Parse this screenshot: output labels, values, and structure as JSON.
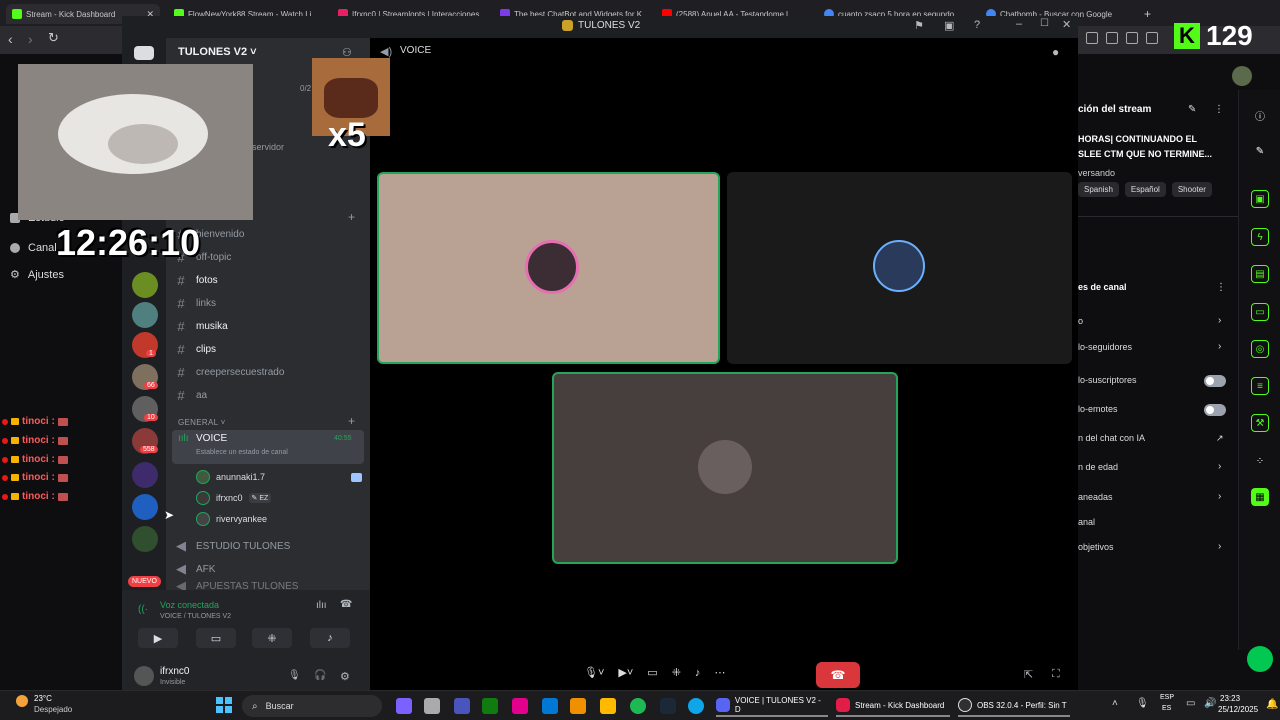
{
  "browser": {
    "tabs": [
      {
        "label": "Stream - Kick Dashboard",
        "color": "#53fc18"
      },
      {
        "label": "FlowNewYork88 Stream - Watch Li...",
        "color": "#53fc18"
      },
      {
        "label": "Ifrxnc0 | Streamlopts | Interacciones...",
        "color": "#e91e63"
      },
      {
        "label": "The best ChatBot and Widgets for K...",
        "color": "#7c3aed"
      },
      {
        "label": "(2588) Anuel AA - Testandome l...",
        "color": "#ff0000"
      },
      {
        "label": "cuanto zsacn 5 hora en segundo...",
        "color": "#4285f4"
      },
      {
        "label": "Chatbomb - Buscar con Google",
        "color": "#4285f4"
      }
    ],
    "new_tab": "+",
    "back": "‹",
    "forward": "›",
    "reload": "↻"
  },
  "overlay": {
    "viewer_count": "129",
    "clock": "12:26:10",
    "emote_multiplier": "x5"
  },
  "kick_left": {
    "items": [
      {
        "label": "Estudio"
      },
      {
        "label": "Canal"
      },
      {
        "label": "Ajustes"
      }
    ],
    "chat": [
      {
        "user": "tinoci :"
      },
      {
        "user": "tinoci :"
      },
      {
        "user": "tinoci :"
      },
      {
        "user": "tinoci :"
      },
      {
        "user": "tinoci :"
      }
    ]
  },
  "discord": {
    "window_title": "TULONES V2",
    "server_name": "TULONES V2",
    "boost": "0/2",
    "servidor": "servidor",
    "voice_header": "VOICE",
    "channels": [
      {
        "name": "bienvenido",
        "dim": true
      },
      {
        "name": "off-topic",
        "dim": true
      },
      {
        "name": "fotos",
        "dim": false
      },
      {
        "name": "links",
        "dim": true
      },
      {
        "name": "musika",
        "dim": false
      },
      {
        "name": "clips",
        "dim": false
      },
      {
        "name": "creepersecuestrado",
        "dim": true
      },
      {
        "name": "aa",
        "dim": true
      }
    ],
    "category": "GENERAL",
    "voice_channel": {
      "name": "VOICE",
      "timer": "40:55",
      "status": "Establece un estado de canal",
      "members": [
        {
          "name": "anunnaki1.7"
        },
        {
          "name": "ifrxnc0",
          "badge": "EZ"
        },
        {
          "name": "rivervyankee"
        }
      ]
    },
    "other_voice": [
      {
        "name": "ESTUDIO TULONES"
      },
      {
        "name": "AFK"
      },
      {
        "name": "APUESTAS TULONES"
      }
    ],
    "rail_badges": [
      {
        "count": "1"
      },
      {
        "count": "66"
      },
      {
        "count": "10"
      },
      {
        "count": "558"
      }
    ],
    "new_label": "NUEVO",
    "voice_status": {
      "title": "Voz conectada",
      "sub": "VOICE / TULONES V2"
    },
    "user": {
      "name": "ifrxnc0",
      "status": "Invisible"
    }
  },
  "kick_right": {
    "header": "ción del stream",
    "title_line1": "HORAS| CONTINUANDO EL",
    "title_line2": "SLEE CTM QUE NO TERMINE...",
    "category": "versando",
    "tags": [
      "Spanish",
      "Español",
      "Shooter"
    ],
    "section": "es de canal",
    "rows": [
      {
        "label": "o",
        "control": "chevron"
      },
      {
        "label": "lo-seguidores",
        "control": "chevron"
      },
      {
        "label": "lo-suscriptores",
        "control": "toggle"
      },
      {
        "label": "lo-emotes",
        "control": "toggle"
      },
      {
        "label": "n del chat con IA",
        "control": "external"
      },
      {
        "label": "n de edad",
        "control": "chevron"
      },
      {
        "label": "aneadas",
        "control": "chevron"
      },
      {
        "label": "anal",
        "control": "none"
      },
      {
        "label": "objetivos",
        "control": "chevron"
      }
    ]
  },
  "taskbar": {
    "weather_temp": "23°C",
    "weather_desc": "Despejado",
    "search_placeholder": "Buscar",
    "apps": [
      {
        "label": "VOICE | TULONES V2 - D"
      },
      {
        "label": "Stream - Kick Dashboard"
      },
      {
        "label": "OBS 32.0.4 - Perfil: Sin T"
      }
    ],
    "lang1": "ESP",
    "lang2": "ES",
    "time": "23:23",
    "date": "25/12/2025"
  }
}
